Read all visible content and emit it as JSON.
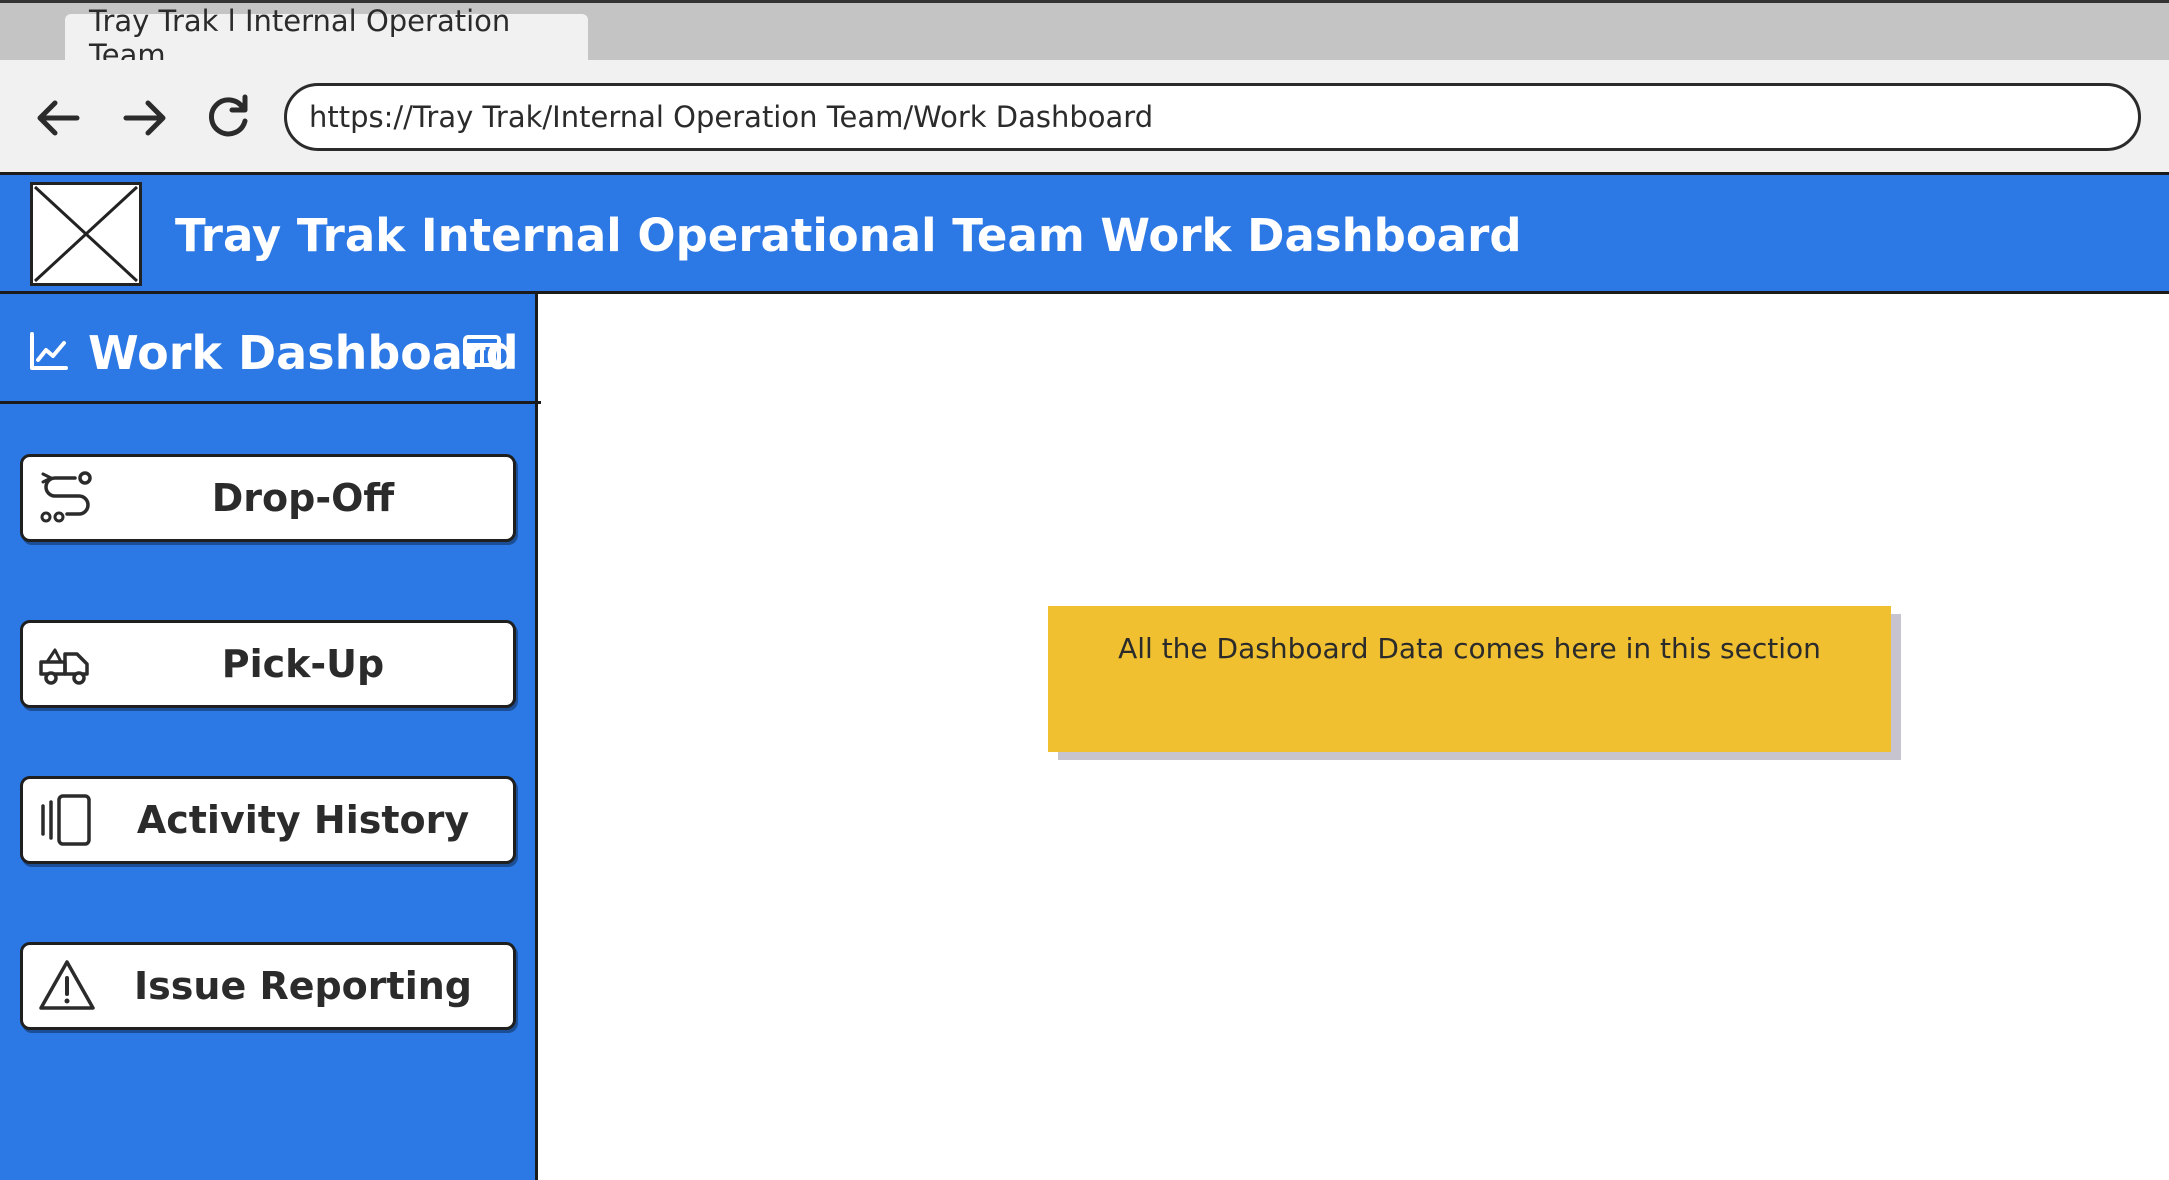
{
  "browser": {
    "tab_title": "Tray Trak l Internal Operation Team",
    "url": "https://Tray Trak/Internal Operation Team/Work Dashboard"
  },
  "header": {
    "title": "Tray Trak Internal Operational Team Work Dashboard"
  },
  "sidebar": {
    "title": "Work Dashboard",
    "items": [
      {
        "label": "Drop-Off",
        "icon": "route-icon"
      },
      {
        "label": "Pick-Up",
        "icon": "truck-icon"
      },
      {
        "label": "Activity History",
        "icon": "history-icon"
      },
      {
        "label": "Issue Reporting",
        "icon": "warning-icon"
      }
    ]
  },
  "main": {
    "placeholder_text": "All the Dashboard Data comes here in this section"
  },
  "colors": {
    "header_blue": "#2c78e5",
    "sticky_yellow": "#f0c030"
  }
}
